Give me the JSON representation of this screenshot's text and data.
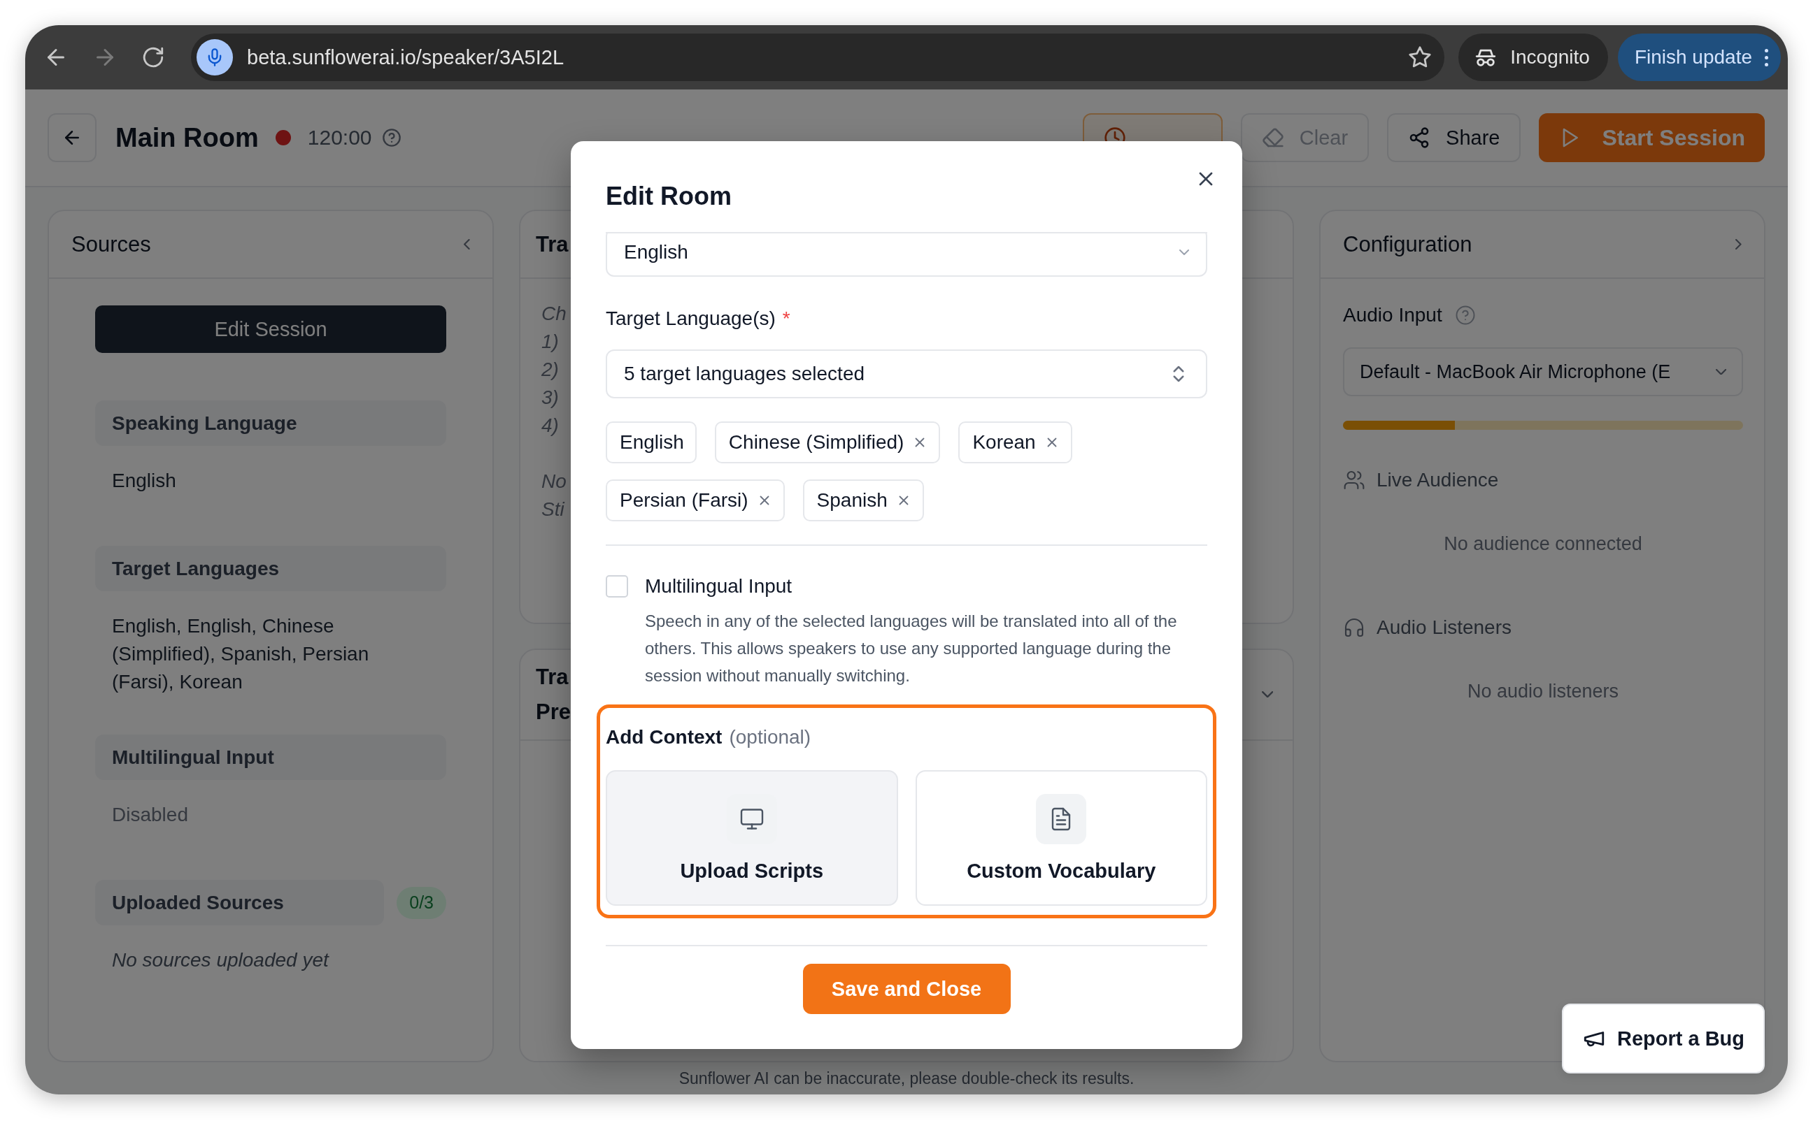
{
  "browser": {
    "url": "beta.sunflowerai.io/speaker/3A5I2L",
    "incognito_label": "Incognito",
    "update_button": "Finish update"
  },
  "header": {
    "title": "Main Room",
    "recording": true,
    "timer": "120:00",
    "buttons": [
      {
        "kind": "usage",
        "disabled": false
      },
      {
        "kind": "clear",
        "label": "Clear",
        "disabled": true
      },
      {
        "kind": "share",
        "label": "Share",
        "disabled": false
      },
      {
        "kind": "start",
        "label": "Start Session",
        "disabled": false
      }
    ]
  },
  "sources": {
    "title": "Sources",
    "edit_button": "Edit Session",
    "sections": [
      {
        "heading": "Speaking Language",
        "kind": "text",
        "value": "English"
      },
      {
        "heading": "Target Languages",
        "kind": "text",
        "value": "English, English, Chinese (Simplified), Spanish, Persian (Farsi), Korean"
      },
      {
        "heading": "Multilingual Input",
        "kind": "muted",
        "value": "Disabled"
      },
      {
        "heading": "Uploaded Sources",
        "kind": "empty",
        "badge": "0/3",
        "value": "No sources uploaded yet"
      }
    ]
  },
  "transcript_panel": {
    "title": "Tra",
    "lines": [
      "Ch",
      "1)",
      "2)",
      "3)",
      "4)"
    ],
    "notes": [
      "No",
      "Sti"
    ]
  },
  "preview_panel": {
    "title_lines": [
      "Tra",
      "Pre"
    ]
  },
  "configuration": {
    "title": "Configuration",
    "audio_input": {
      "label": "Audio Input",
      "device": "Default - MacBook Air Microphone (E",
      "level": 0.28
    },
    "live_audience": {
      "title": "Live Audience",
      "empty": "No audience connected"
    },
    "audio_listeners": {
      "title": "Audio Listeners",
      "empty": "No audio listeners"
    }
  },
  "footer": "Sunflower AI can be inaccurate, please double-check its results.",
  "report_button": "Report a Bug",
  "modal": {
    "title": "Edit Room",
    "speaking_language_value": "English",
    "target_field": {
      "label": "Target Language(s)",
      "required_mark": "*",
      "value": "5 target languages selected"
    },
    "chips": [
      {
        "label": "English",
        "removable": false
      },
      {
        "label": "Chinese (Simplified)",
        "removable": true
      },
      {
        "label": "Korean",
        "removable": true
      },
      {
        "label": "Persian (Farsi)",
        "removable": true
      },
      {
        "label": "Spanish",
        "removable": true
      }
    ],
    "multilingual": {
      "label": "Multilingual Input",
      "checked": false,
      "description": "Speech in any of the selected languages will be translated into all of the others. This allows speakers to use any supported language during the session without manually switching."
    },
    "context": {
      "title": "Add Context",
      "note": "(optional)",
      "highlighted": true,
      "options": [
        {
          "kind": "scripts",
          "label": "Upload Scripts",
          "hovered": true
        },
        {
          "kind": "vocabulary",
          "label": "Custom Vocabulary",
          "hovered": false
        }
      ]
    },
    "save_button": "Save and Close"
  }
}
